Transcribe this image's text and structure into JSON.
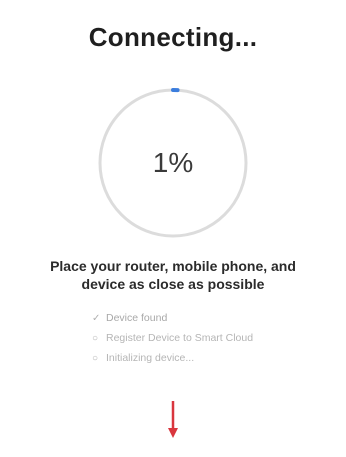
{
  "screen": {
    "title": "Connecting..."
  },
  "progress": {
    "percent_label": "1%",
    "value": 0.01,
    "track_color": "#dcdcdc",
    "indicator_color": "#3b7ddd"
  },
  "instruction": {
    "line1": "Place your router, mobile phone, and",
    "line2": "device as close as possible"
  },
  "steps": [
    {
      "status": "done",
      "icon": "check-icon",
      "mark": "✓",
      "label": "Device found"
    },
    {
      "status": "pending",
      "icon": "pending-dot-icon",
      "mark": "○",
      "label": "Register Device to Smart Cloud"
    },
    {
      "status": "pending",
      "icon": "pending-dot-icon",
      "mark": "○",
      "label": "Initializing device..."
    }
  ],
  "annotation": {
    "icon": "arrow-down-icon",
    "color": "#d9363e"
  }
}
